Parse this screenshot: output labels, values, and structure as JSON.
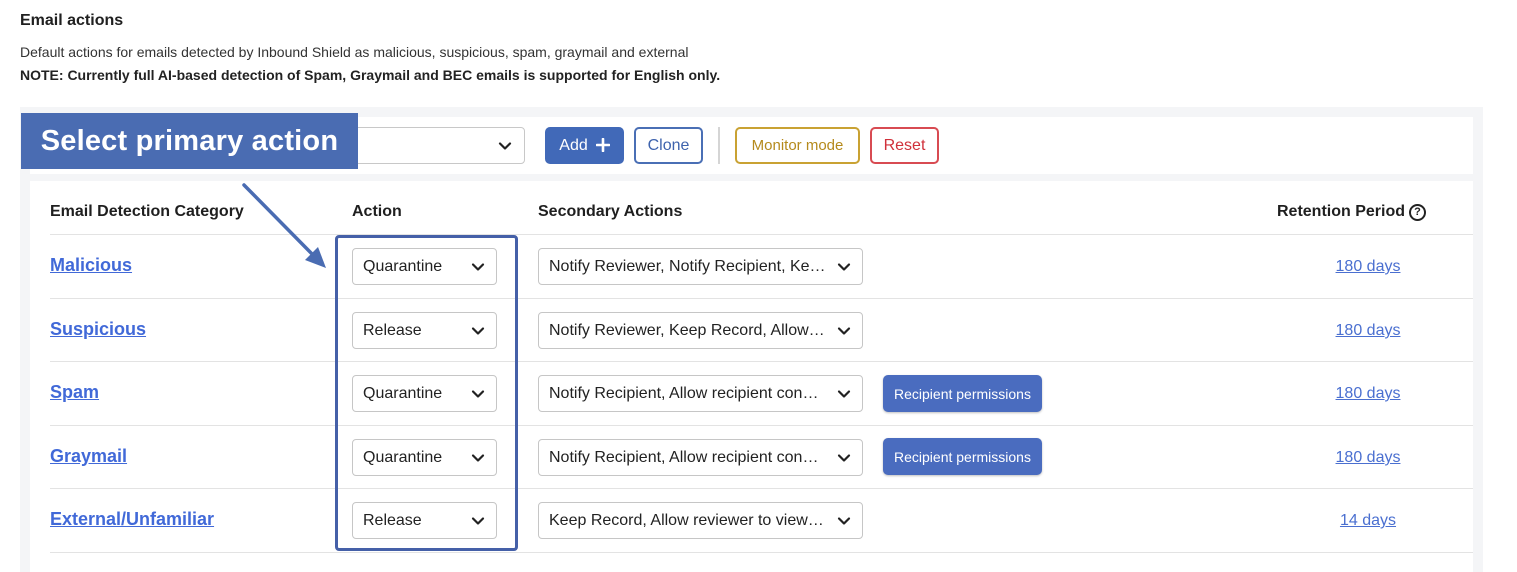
{
  "header": {
    "title": "Email actions",
    "description": "Default actions for emails detected by Inbound Shield as malicious, suspicious, spam, graymail and external",
    "note": "NOTE: Currently full AI-based detection of Spam, Graymail and BEC emails is supported for English only."
  },
  "toolbar": {
    "policy_select_value": "",
    "add_label": "Add",
    "add_icon": "plus-icon",
    "clone_label": "Clone",
    "monitor_label": "Monitor mode",
    "reset_label": "Reset"
  },
  "callout": {
    "text": "Select primary action"
  },
  "table": {
    "headers": {
      "category": "Email Detection Category",
      "action": "Action",
      "secondary": "Secondary Actions",
      "retention": "Retention Period",
      "retention_icon": "help-circle-icon"
    },
    "rows": [
      {
        "category": "Malicious",
        "action": "Quarantine",
        "secondary": "Notify Reviewer, Notify Recipient, Ke…",
        "permissions": "",
        "retention": "180 days"
      },
      {
        "category": "Suspicious",
        "action": "Release",
        "secondary": "Notify Reviewer, Keep Record, Allow…",
        "permissions": "",
        "retention": "180 days"
      },
      {
        "category": "Spam",
        "action": "Quarantine",
        "secondary": "Notify Recipient, Allow recipient con…",
        "permissions": "Recipient permissions",
        "retention": "180 days"
      },
      {
        "category": "Graymail",
        "action": "Quarantine",
        "secondary": "Notify Recipient, Allow recipient con…",
        "permissions": "Recipient permissions",
        "retention": "180 days"
      },
      {
        "category": "External/Unfamiliar",
        "action": "Release",
        "secondary": "Keep Record, Allow reviewer to view…",
        "permissions": "",
        "retention": "14 days"
      }
    ]
  },
  "colors": {
    "primary": "#4169b8",
    "callout": "#4a6cb2",
    "monitor": "#c9a233",
    "reset": "#d84b52",
    "link": "#4169d8"
  }
}
